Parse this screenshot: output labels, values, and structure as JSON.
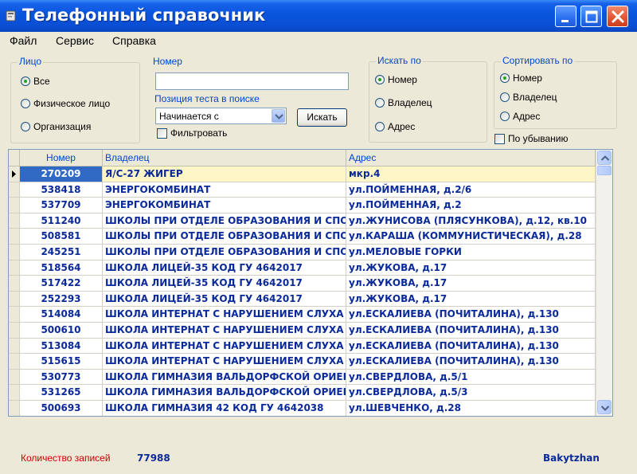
{
  "window": {
    "title": "Телефонный справочник"
  },
  "menu": [
    "Файл",
    "Сервис",
    "Справка"
  ],
  "face_group": {
    "label": "Лицо",
    "options": [
      {
        "label": "Все",
        "checked": true
      },
      {
        "label": "Физическое лицо",
        "checked": false
      },
      {
        "label": "Организация",
        "checked": false
      }
    ]
  },
  "number_group": {
    "label": "Номер",
    "input_value": "",
    "position_label": "Позиция теста в поиске",
    "position_select": "Начинается с",
    "search_button": "Искать",
    "filter_label": "Фильтровать"
  },
  "search_by": {
    "label": "Искать по",
    "options": [
      {
        "label": "Номер",
        "checked": true
      },
      {
        "label": "Владелец",
        "checked": false
      },
      {
        "label": "Адрес",
        "checked": false
      }
    ]
  },
  "sort_by": {
    "label": "Сортировать по",
    "options": [
      {
        "label": "Номер",
        "checked": true
      },
      {
        "label": "Владелец",
        "checked": false
      },
      {
        "label": "Адрес",
        "checked": false
      }
    ],
    "descending_label": "По убыванию"
  },
  "table": {
    "columns": [
      "Номер",
      "Владелец",
      "Адрес"
    ],
    "selected_index": 0,
    "rows": [
      [
        "270209",
        "Я/С-27 ЖИГЕР",
        "мкр.4"
      ],
      [
        "538418",
        "ЭНЕРГОКОМБИНАТ",
        "ул.ПОЙМЕННАЯ, д.2/6"
      ],
      [
        "537709",
        "ЭНЕРГОКОМБИНАТ",
        "ул.ПОЙМЕННАЯ, д.2"
      ],
      [
        "511240",
        "ШКОЛЫ ПРИ ОТДЕЛЕ ОБРАЗОВАНИЯ И СПОРТА",
        "ул.ЖУНИСОВА (ПЛЯСУНКОВА), д.12, кв.10"
      ],
      [
        "508581",
        "ШКОЛЫ ПРИ ОТДЕЛЕ ОБРАЗОВАНИЯ И СПОРТА",
        "ул.КАРАША (КОММУНИСТИЧЕСКАЯ), д.28"
      ],
      [
        "245251",
        "ШКОЛЫ ПРИ ОТДЕЛЕ ОБРАЗОВАНИЯ И СПОРТА",
        "ул.МЕЛОВЫЕ ГОРКИ"
      ],
      [
        "518564",
        "ШКОЛА ЛИЦЕЙ-35 КОД ГУ 4642017",
        "ул.ЖУКОВА, д.17"
      ],
      [
        "517422",
        "ШКОЛА ЛИЦЕЙ-35 КОД ГУ 4642017",
        "ул.ЖУКОВА, д.17"
      ],
      [
        "252293",
        "ШКОЛА ЛИЦЕЙ-35 КОД ГУ 4642017",
        "ул.ЖУКОВА, д.17"
      ],
      [
        "514084",
        "ШКОЛА ИНТЕРНАТ С НАРУШЕНИЕМ СЛУХА И РЕ",
        "ул.ЕСКАЛИЕВА (ПОЧИТАЛИНА), д.130"
      ],
      [
        "500610",
        "ШКОЛА ИНТЕРНАТ С НАРУШЕНИЕМ СЛУХА И РЕ",
        "ул.ЕСКАЛИЕВА (ПОЧИТАЛИНА), д.130"
      ],
      [
        "513084",
        "ШКОЛА ИНТЕРНАТ С НАРУШЕНИЕМ СЛУХА И РЕ",
        "ул.ЕСКАЛИЕВА (ПОЧИТАЛИНА), д.130"
      ],
      [
        "515615",
        "ШКОЛА ИНТЕРНАТ С НАРУШЕНИЕМ СЛУХА И РЕ",
        "ул.ЕСКАЛИЕВА (ПОЧИТАЛИНА), д.130"
      ],
      [
        "530773",
        "ШКОЛА ГИМНАЗИЯ ВАЛЬДОРФСКОЙ ОРИЕНТАЦ",
        "ул.СВЕРДЛОВА, д.5/1"
      ],
      [
        "531265",
        "ШКОЛА ГИМНАЗИЯ ВАЛЬДОРФСКОЙ ОРИЕНТАЦ",
        "ул.СВЕРДЛОВА, д.5/3"
      ],
      [
        "500693",
        "ШКОЛА ГИМНАЗИЯ 42 КОД ГУ 4642038",
        "ул.ШЕВЧЕНКО, д.28"
      ]
    ]
  },
  "status": {
    "count_label": "Количество записей",
    "count_value": "77988",
    "user": "Bakytzhan"
  }
}
